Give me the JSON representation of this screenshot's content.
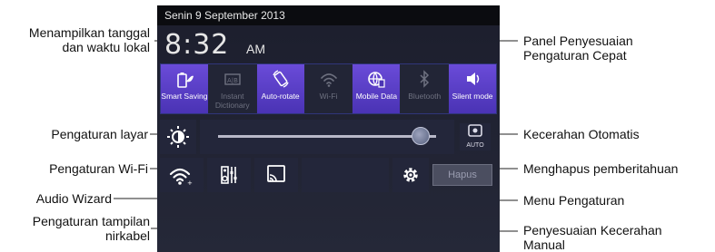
{
  "status_bar": {
    "date": "Senin 9 September 2013"
  },
  "clock": {
    "time": "8:32",
    "ampm": "AM"
  },
  "quick_settings": [
    {
      "label": "Smart Saving",
      "icon": "battery-leaf-icon",
      "state": "on"
    },
    {
      "label": "Instant Dictionary",
      "icon": "dictionary-icon",
      "state": "off"
    },
    {
      "label": "Auto-rotate",
      "icon": "rotate-icon",
      "state": "on"
    },
    {
      "label": "Wi-Fi",
      "icon": "wifi-icon",
      "state": "off"
    },
    {
      "label": "Mobile Data",
      "icon": "globe-data-icon",
      "state": "on"
    },
    {
      "label": "Bluetooth",
      "icon": "bluetooth-icon",
      "state": "off"
    },
    {
      "label": "Silent mode",
      "icon": "speaker-icon",
      "state": "on"
    }
  ],
  "brightness": {
    "level": 0.93,
    "auto_label": "AUTO"
  },
  "clear_button": {
    "label": "Hapus"
  },
  "callouts": {
    "date_time": "Menampilkan tanggal\ndan waktu lokal",
    "quick_panel": "Panel Penyesuaian\nPengaturan Cepat",
    "screen_settings": "Pengaturan layar",
    "auto_brightness": "Kecerahan Otomatis",
    "wifi_settings": "Pengaturan Wi-Fi",
    "clear_notifications": "Menghapus pemberitahuan",
    "audio_wizard": "Audio Wizard",
    "settings_menu": "Menu Pengaturan",
    "wireless_display": "Pengaturan tampilan\nnirkabel",
    "manual_brightness": "Penyesuaian Kecerahan\nManual"
  },
  "colors": {
    "active": "#5a3fd0",
    "panel": "#1f2232",
    "accent": "#7b6cff"
  }
}
